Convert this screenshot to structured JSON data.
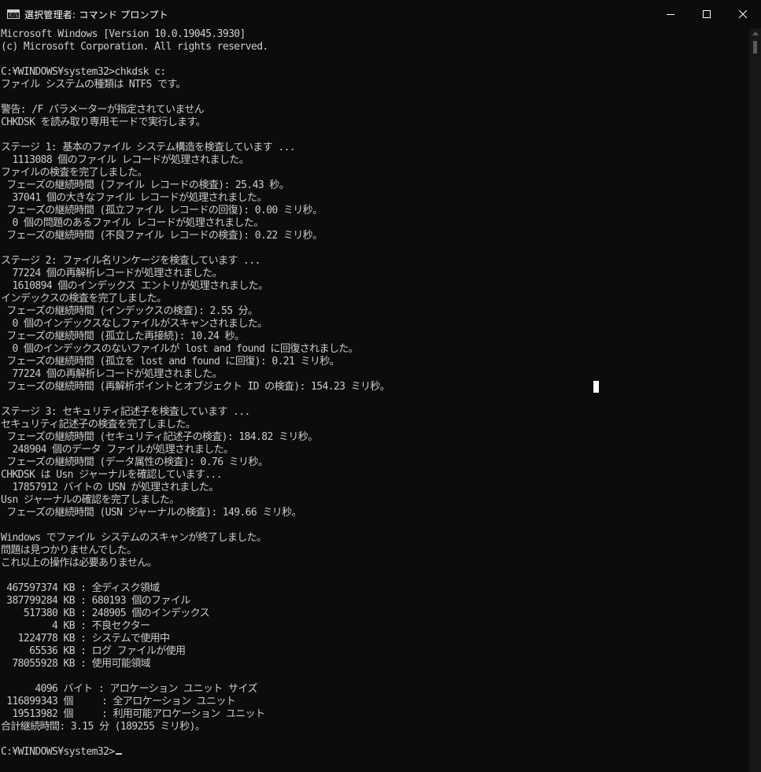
{
  "window": {
    "title": "選択管理者: コマンド プロンプト",
    "icon_text": "C:\\"
  },
  "icons": {
    "app": "cmd-icon",
    "minimize": "minimize-icon",
    "maximize": "maximize-icon",
    "close": "close-icon"
  },
  "colors": {
    "background": "#0c0c0c",
    "text": "#cccccc",
    "cursor": "#ffffff"
  },
  "console": {
    "lines": [
      "Microsoft Windows [Version 10.0.19045.3930]",
      "(c) Microsoft Corporation. All rights reserved.",
      "",
      "C:¥WINDOWS¥system32>chkdsk c:",
      "ファイル システムの種類は NTFS です。",
      "",
      "警告: /F パラメーターが指定されていません",
      "CHKDSK を読み取り専用モードで実行します。",
      "",
      "ステージ 1: 基本のファイル システム構造を検査しています ...",
      "  1113088 個のファイル レコードが処理されました。",
      "ファイルの検査を完了しました。",
      " フェーズの継続時間 (ファイル レコードの検査): 25.43 秒。",
      "  37041 個の大きなファイル レコードが処理されました。",
      " フェーズの継続時間 (孤立ファイル レコードの回復): 0.00 ミリ秒。",
      "  0 個の問題のあるファイル レコードが処理されました。",
      " フェーズの継続時間 (不良ファイル レコードの検査): 0.22 ミリ秒。",
      "",
      "ステージ 2: ファイル名リンケージを検査しています ...",
      "  77224 個の再解析レコードが処理されました。",
      "  1610894 個のインデックス エントリが処理されました。",
      "インデックスの検査を完了しました。",
      " フェーズの継続時間 (インデックスの検査): 2.55 分。",
      "  0 個のインデックスなしファイルがスキャンされました。",
      " フェーズの継続時間 (孤立した再接続): 10.24 秒。",
      "  0 個のインデックスのないファイルが lost and found に回復されました。",
      " フェーズの継続時間 (孤立を lost and found に回復): 0.21 ミリ秒。",
      "  77224 個の再解析レコードが処理されました。",
      " フェーズの継続時間 (再解析ポイントとオブジェクト ID の検査): 154.23 ミリ秒。",
      "",
      "ステージ 3: セキュリティ記述子を検査しています ...",
      "セキュリティ記述子の検査を完了しました。",
      " フェーズの継続時間 (セキュリティ記述子の検査): 184.82 ミリ秒。",
      "  248904 個のデータ ファイルが処理されました。",
      " フェーズの継続時間 (データ属性の検査): 0.76 ミリ秒。",
      "CHKDSK は Usn ジャーナルを確認しています...",
      "  17857912 バイトの USN が処理されました。",
      "Usn ジャーナルの確認を完了しました。",
      " フェーズの継続時間 (USN ジャーナルの検査): 149.66 ミリ秒。",
      "",
      "Windows でファイル システムのスキャンが終了しました。",
      "問題は見つかりませんでした。",
      "これ以上の操作は必要ありません。",
      "",
      " 467597374 KB : 全ディスク領域",
      " 387799284 KB : 680193 個のファイル",
      "    517380 KB : 248905 個のインデックス",
      "         4 KB : 不良セクター",
      "   1224778 KB : システムで使用中",
      "     65536 KB : ログ ファイルが使用",
      "  78055928 KB : 使用可能領域",
      "",
      "      4096 バイト : アロケーション ユニット サイズ",
      " 116899343 個     : 全アロケーション ユニット",
      "  19513982 個     : 利用可能アロケーション ユニット",
      "合計継続時間: 3.15 分 (189255 ミリ秒)。",
      "",
      "C:¥WINDOWS¥system32>"
    ]
  }
}
